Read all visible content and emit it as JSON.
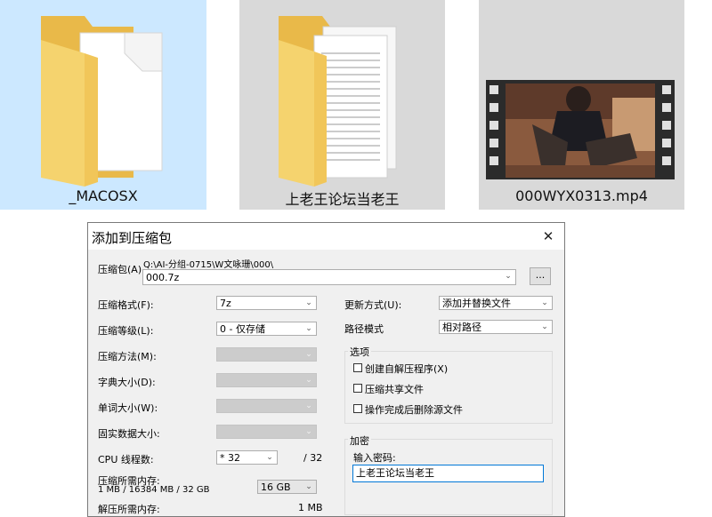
{
  "explorer": {
    "items": [
      {
        "name": "_MACOSX",
        "icon": "folder-icon"
      },
      {
        "name": "上老王论坛当老王",
        "icon": "folder-icon"
      },
      {
        "name": "000WYX0313.mp4",
        "icon": "video-thumbnail-icon"
      }
    ]
  },
  "dialog": {
    "title": "添加到压缩包",
    "close_glyph": "✕",
    "archive": {
      "label": "压缩包(A)",
      "path": "Q:\\AI-分组-0715\\W文咏珊\\000\\",
      "value": "000.7z",
      "browse_label": "..."
    },
    "left": {
      "format_label": "压缩格式(F):",
      "format_value": "7z",
      "level_label": "压缩等级(L):",
      "level_value": "0 - 仅存储",
      "method_label": "压缩方法(M):",
      "dict_label": "字典大小(D):",
      "word_label": "单词大小(W):",
      "solid_label": "固实数据大小:",
      "cpu_label": "CPU 线程数:",
      "cpu_value": "* 32",
      "cpu_total": "/ 32",
      "mem_label": "压缩所需内存:",
      "mem_detail": "1 MB / 16384 MB / 32 GB",
      "mem_value": "16 GB",
      "dmem_label": "解压所需内存:",
      "dmem_value": "1 MB"
    },
    "right": {
      "update_label": "更新方式(U):",
      "update_value": "添加并替换文件",
      "pathmode_label": "路径模式",
      "pathmode_value": "相对路径",
      "options_title": "选项",
      "opt_sfx": "创建自解压程序(X)",
      "opt_shared": "压缩共享文件",
      "opt_delete": "操作完成后删除源文件",
      "encrypt_title": "加密",
      "pwd_label": "输入密码:",
      "pwd_value": "上老王论坛当老王"
    }
  },
  "colors": {
    "selected_tile": "#cce8ff",
    "tile": "#d9d9d9",
    "dialog_bg": "#f0f0f0",
    "focus_border": "#0078d7"
  }
}
